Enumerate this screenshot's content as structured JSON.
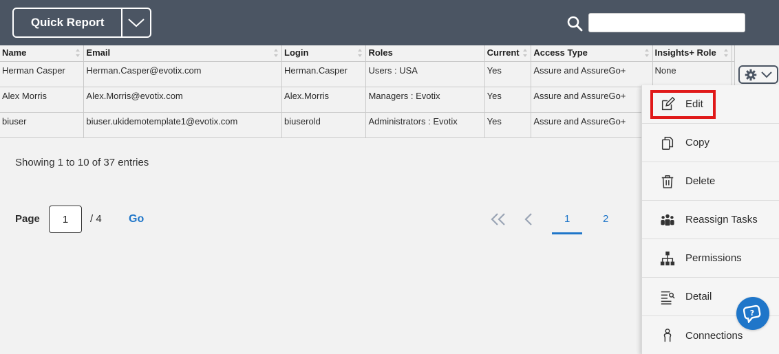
{
  "toolbar": {
    "quick_report_label": "Quick Report",
    "search_placeholder": ""
  },
  "table": {
    "columns": [
      "Name",
      "Email",
      "Login",
      "Roles",
      "Current",
      "Access Type",
      "Insights+ Role"
    ],
    "rows": [
      {
        "name": "Herman Casper",
        "email": "Herman.Casper@evotix.com",
        "login": "Herman.Casper",
        "roles": "Users : USA",
        "current": "Yes",
        "access_type": "Assure and AssureGo+",
        "insights_role": "None"
      },
      {
        "name": "Alex Morris",
        "email": "Alex.Morris@evotix.com",
        "login": "Alex.Morris",
        "roles": "Managers : Evotix",
        "current": "Yes",
        "access_type": "Assure and AssureGo+",
        "insights_role": ""
      },
      {
        "name": "biuser",
        "email": "biuser.ukidemotemplate1@evotix.com",
        "login": "biuserold",
        "roles": "Administrators : Evotix",
        "current": "Yes",
        "access_type": "Assure and AssureGo+",
        "insights_role": ""
      }
    ]
  },
  "info": {
    "showing": "Showing 1 to 10 of 37 entries"
  },
  "pagination": {
    "page_label": "Page",
    "current_page": "1",
    "total": "/ 4",
    "go_label": "Go",
    "pages": [
      "1",
      "2"
    ]
  },
  "menu": {
    "items": [
      {
        "label": "Edit",
        "icon": "edit-icon"
      },
      {
        "label": "Copy",
        "icon": "copy-icon"
      },
      {
        "label": "Delete",
        "icon": "trash-icon"
      },
      {
        "label": "Reassign Tasks",
        "icon": "users-icon"
      },
      {
        "label": "Permissions",
        "icon": "hierarchy-icon"
      },
      {
        "label": "Detail",
        "icon": "detail-list-icon"
      },
      {
        "label": "Connections",
        "icon": "person-icon"
      }
    ]
  },
  "colors": {
    "topbar": "#4b5563",
    "link": "#1f76c9",
    "highlight": "#e01919"
  }
}
